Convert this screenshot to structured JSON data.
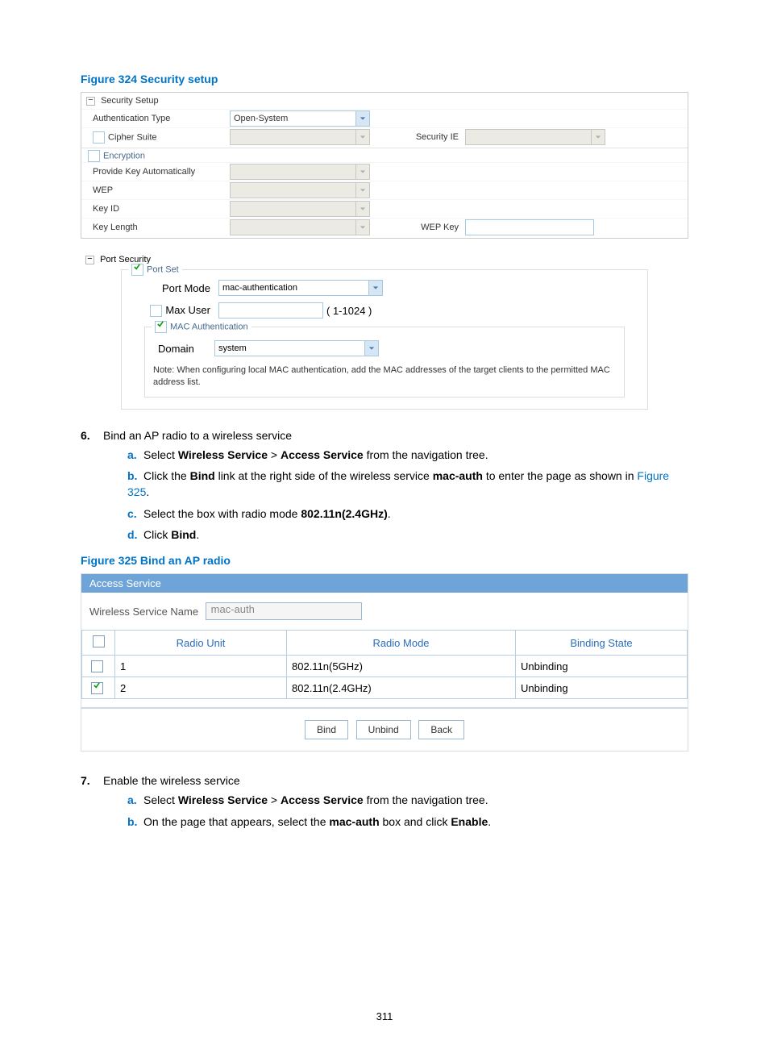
{
  "fig324_caption": "Figure 324 Security setup",
  "security_setup": {
    "title": "Security Setup",
    "auth_type_label": "Authentication Type",
    "auth_type_value": "Open-System",
    "cipher_suite_label": "Cipher Suite",
    "security_ie_label": "Security IE",
    "encryption_label": "Encryption",
    "provide_key_label": "Provide Key Automatically",
    "wep_label": "WEP",
    "key_id_label": "Key ID",
    "key_length_label": "Key Length",
    "wep_key_label": "WEP Key"
  },
  "port_security": {
    "title": "Port Security",
    "port_set_label": "Port Set",
    "port_mode_label": "Port Mode",
    "port_mode_value": "mac-authentication",
    "max_user_label": "Max User",
    "max_user_range": "( 1-1024 )",
    "mac_auth_label": "MAC Authentication",
    "domain_label": "Domain",
    "domain_value": "system",
    "note": "Note: When configuring local MAC authentication, add the MAC addresses of the target clients to the permitted MAC address list."
  },
  "step6": {
    "num": "6.",
    "text": "Bind an AP radio to a wireless service",
    "a": {
      "m": "a.",
      "pre": "Select ",
      "b1": "Wireless Service",
      "gt": " > ",
      "b2": "Access Service",
      "post": " from the navigation tree."
    },
    "b": {
      "m": "b.",
      "pre": "Click the ",
      "b1": "Bind",
      "mid": " link at the right side of the wireless service ",
      "b2": "mac-auth",
      "post": " to enter the page as shown in ",
      "link": "Figure 325",
      "end": "."
    },
    "c": {
      "m": "c.",
      "pre": "Select the box with radio mode ",
      "b1": "802.11n(2.4GHz)",
      "post": "."
    },
    "d": {
      "m": "d.",
      "pre": "Click ",
      "b1": "Bind",
      "post": "."
    }
  },
  "fig325_caption": "Figure 325 Bind an AP radio",
  "bind_screen": {
    "header": "Access Service",
    "wsn_label": "Wireless Service Name",
    "wsn_value": "mac-auth",
    "th_unit": "Radio Unit",
    "th_mode": "Radio Mode",
    "th_state": "Binding State",
    "rows": [
      {
        "checked": false,
        "unit": "1",
        "mode": "802.11n(5GHz)",
        "state": "Unbinding"
      },
      {
        "checked": true,
        "unit": "2",
        "mode": "802.11n(2.4GHz)",
        "state": "Unbinding"
      }
    ],
    "btn_bind": "Bind",
    "btn_unbind": "Unbind",
    "btn_back": "Back"
  },
  "step7": {
    "num": "7.",
    "text": "Enable the wireless service",
    "a": {
      "m": "a.",
      "pre": "Select ",
      "b1": "Wireless Service",
      "gt": " > ",
      "b2": "Access Service",
      "post": " from the navigation tree."
    },
    "b": {
      "m": "b.",
      "pre": "On the page that appears, select the ",
      "b1": "mac-auth",
      "mid": " box and click ",
      "b2": "Enable",
      "post": "."
    }
  },
  "page_num": "311"
}
